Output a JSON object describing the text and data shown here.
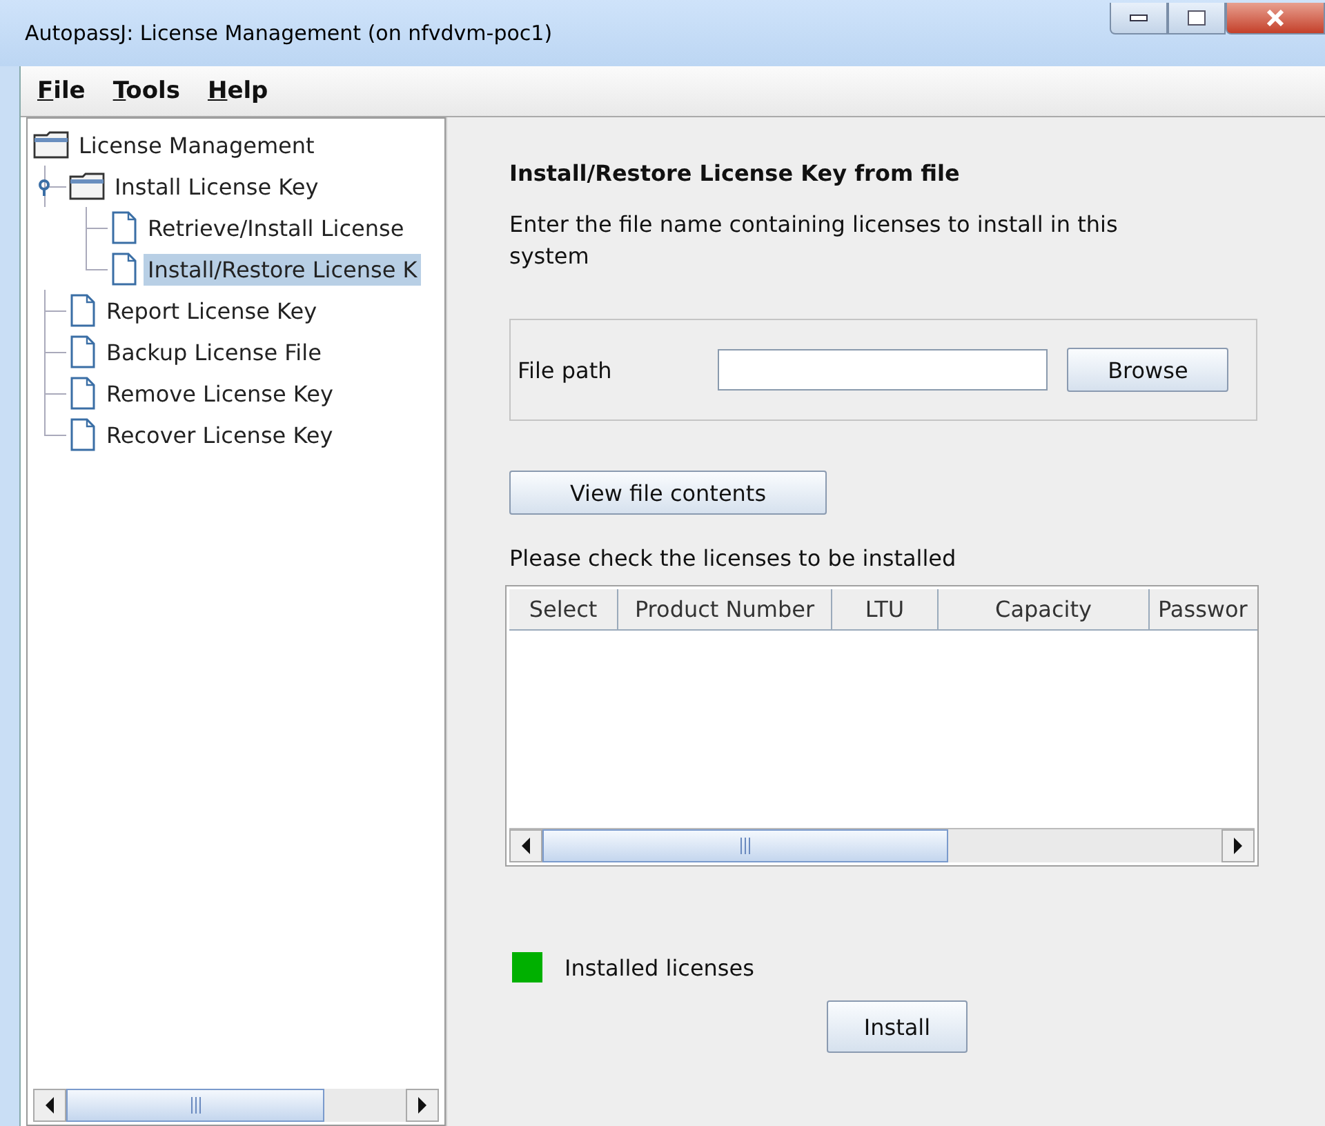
{
  "window": {
    "title": "AutopassJ: License Management (on nfvdvm-poc1)"
  },
  "menu": [
    "File",
    "Tools",
    "Help"
  ],
  "tree": [
    {
      "label": "License Management",
      "kind": "folder",
      "selected": false,
      "children": [
        {
          "label": "Install License Key",
          "kind": "folder",
          "selected": false,
          "expanded": true,
          "children": [
            {
              "label": "Retrieve/Install License",
              "kind": "file",
              "selected": false
            },
            {
              "label": "Install/Restore License K",
              "kind": "file",
              "selected": true
            }
          ]
        },
        {
          "label": "Report License Key",
          "kind": "file",
          "selected": false
        },
        {
          "label": "Backup License File",
          "kind": "file",
          "selected": false
        },
        {
          "label": "Remove License Key",
          "kind": "file",
          "selected": false
        },
        {
          "label": "Recover License Key",
          "kind": "file",
          "selected": false
        }
      ]
    }
  ],
  "panel": {
    "heading": "Install/Restore License Key from file",
    "description": "Enter the file name containing licenses to install in this system",
    "file_path": {
      "label": "File path",
      "browse_button": "Browse"
    },
    "view_button": "View file contents",
    "table_caption": "Please check the licenses to be installed",
    "table": {
      "columns": [
        "Select",
        "Product Number",
        "LTU",
        "Capacity",
        "Passwor"
      ]
    },
    "legend": {
      "label": "Installed licenses",
      "color": "#00b000"
    },
    "install_button": "Install"
  }
}
